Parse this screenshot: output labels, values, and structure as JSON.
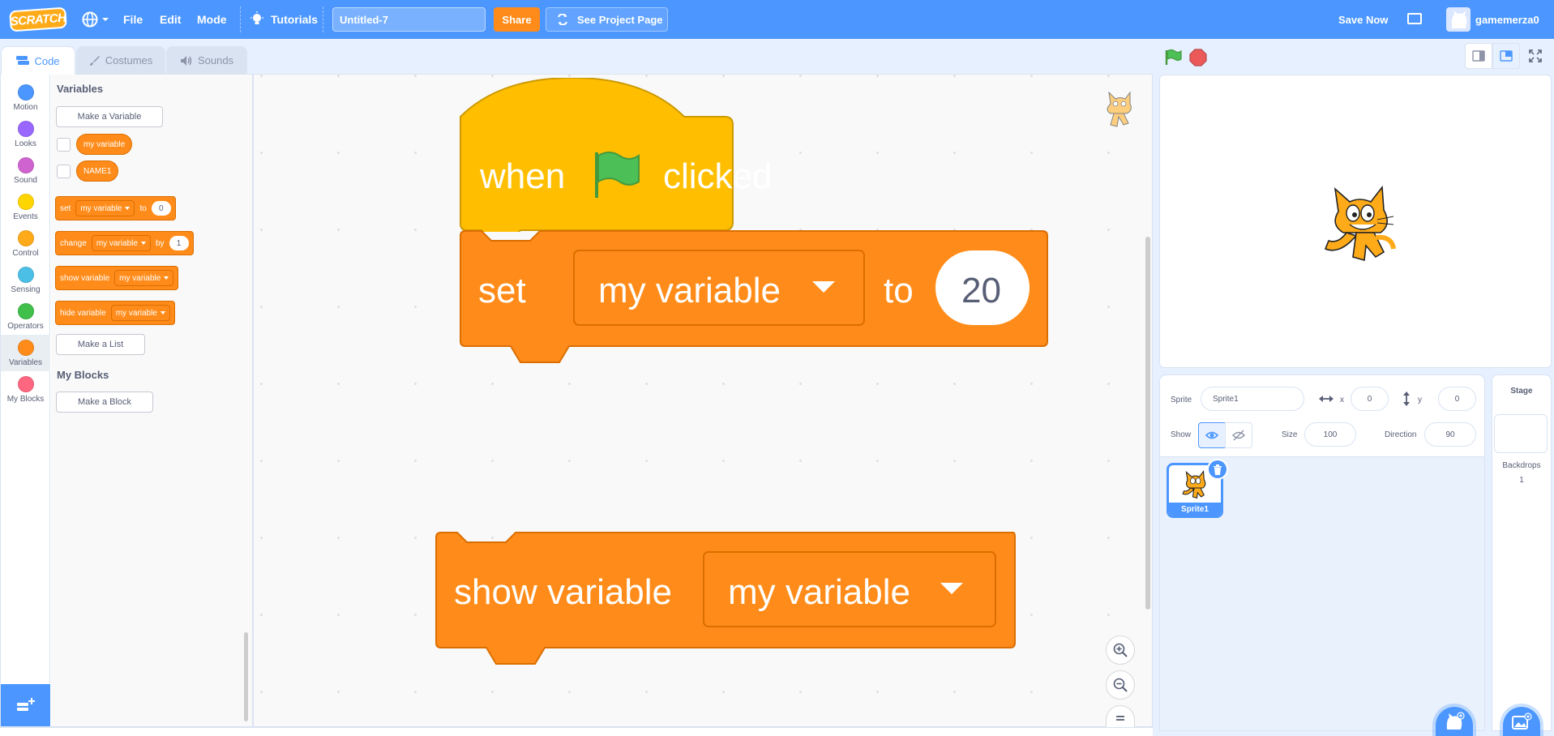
{
  "menubar": {
    "logo_text": "SCRATCH",
    "file": "File",
    "edit": "Edit",
    "mode": "Mode",
    "tutorials": "Tutorials",
    "project_title": "Untitled-7",
    "share": "Share",
    "see_project_page": "See Project Page",
    "save_now": "Save Now",
    "username": "gamemerza0"
  },
  "tabs": [
    {
      "label": "Code",
      "active": true
    },
    {
      "label": "Costumes",
      "active": false
    },
    {
      "label": "Sounds",
      "active": false
    }
  ],
  "categories": [
    {
      "label": "Motion",
      "color": "#4c97ff"
    },
    {
      "label": "Looks",
      "color": "#9966ff"
    },
    {
      "label": "Sound",
      "color": "#cf63cf"
    },
    {
      "label": "Events",
      "color": "#ffd500"
    },
    {
      "label": "Control",
      "color": "#ffab19"
    },
    {
      "label": "Sensing",
      "color": "#4cbfe6"
    },
    {
      "label": "Operators",
      "color": "#40bf4a"
    },
    {
      "label": "Variables",
      "color": "#ff8c1a"
    },
    {
      "label": "My Blocks",
      "color": "#ff6680"
    }
  ],
  "palette": {
    "variables_heading": "Variables",
    "make_variable": "Make a Variable",
    "var1": "my variable",
    "var2": "NAME1",
    "set_block": {
      "word": "set",
      "var": "my variable",
      "to": "to",
      "value": "0"
    },
    "change_block": {
      "word": "change",
      "var": "my variable",
      "by": "by",
      "value": "1"
    },
    "show_block": {
      "word": "show variable",
      "var": "my variable"
    },
    "hide_block": {
      "word": "hide variable",
      "var": "my variable"
    },
    "make_list": "Make a List",
    "myblocks_heading": "My Blocks",
    "make_block": "Make a Block"
  },
  "script": {
    "when": "when",
    "clicked": "clicked",
    "set": "set",
    "set_var": "my variable",
    "to": "to",
    "set_value": "20",
    "show_variable": "show variable",
    "show_var": "my variable"
  },
  "sprite_info": {
    "sprite_label": "Sprite",
    "sprite_name": "Sprite1",
    "x_label": "x",
    "x_value": "0",
    "y_label": "y",
    "y_value": "0",
    "show_label": "Show",
    "size_label": "Size",
    "size_value": "100",
    "direction_label": "Direction",
    "direction_value": "90"
  },
  "sprite_list": [
    {
      "name": "Sprite1",
      "selected": true
    }
  ],
  "stage_panel": {
    "title": "Stage",
    "backdrops_label": "Backdrops",
    "backdrops_count": "1"
  },
  "colors": {
    "menu_blue": "#4c97ff",
    "variables_orange": "#ff8c1a",
    "events_yellow": "#ffbf00"
  }
}
